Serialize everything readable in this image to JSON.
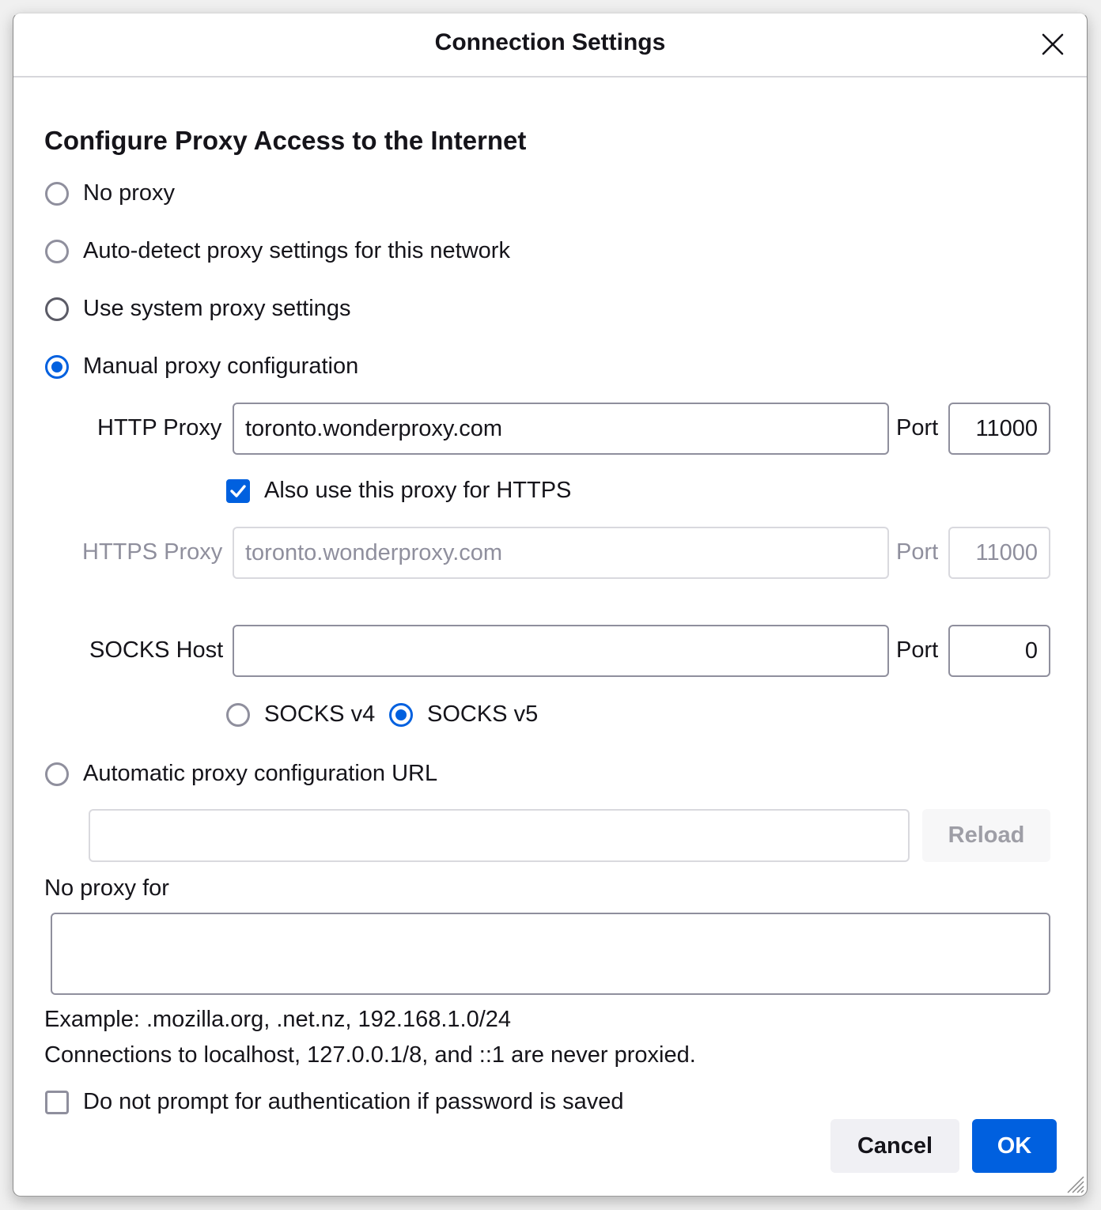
{
  "dialog": {
    "title": "Connection Settings",
    "close_icon": "close-icon"
  },
  "section": {
    "heading": "Configure Proxy Access to the Internet"
  },
  "proxy_modes": [
    {
      "label": "No proxy",
      "selected": false
    },
    {
      "label": "Auto-detect proxy settings for this network",
      "selected": false
    },
    {
      "label": "Use system proxy settings",
      "selected": false
    },
    {
      "label": "Manual proxy configuration",
      "selected": true
    },
    {
      "label": "Automatic proxy configuration URL",
      "selected": false
    }
  ],
  "manual": {
    "http_proxy_label": "HTTP Proxy",
    "http_proxy_value": "toronto.wonderproxy.com",
    "http_port_label": "Port",
    "http_port_value": "11000",
    "also_https_label": "Also use this proxy for HTTPS",
    "also_https_checked": true,
    "https_proxy_label": "HTTPS Proxy",
    "https_proxy_value": "toronto.wonderproxy.com",
    "https_port_label": "Port",
    "https_port_value": "11000",
    "socks_host_label": "SOCKS Host",
    "socks_host_value": "",
    "socks_port_label": "Port",
    "socks_port_value": "0",
    "socks_v4_label": "SOCKS v4",
    "socks_v5_label": "SOCKS v5",
    "socks_version_selected": "SOCKS v5"
  },
  "auto_config": {
    "url_value": "",
    "reload_label": "Reload"
  },
  "no_proxy": {
    "label": "No proxy for",
    "value": "",
    "example": "Example: .mozilla.org, .net.nz, 192.168.1.0/24",
    "note": "Connections to localhost, 127.0.0.1/8, and ::1 are never proxied."
  },
  "auth": {
    "label": "Do not prompt for authentication if password is saved",
    "checked": false
  },
  "footer": {
    "cancel_label": "Cancel",
    "ok_label": "OK"
  },
  "colors": {
    "accent": "#0060df",
    "disabled_text": "#8f8f9d",
    "button_secondary_bg": "#f0f0f4"
  }
}
